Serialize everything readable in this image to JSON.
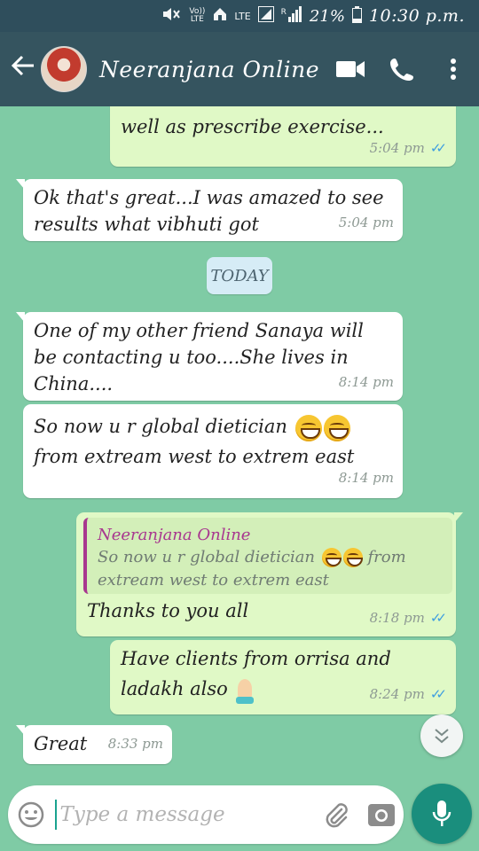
{
  "status_bar": {
    "signal_labels": [
      "Vo)) LTE",
      "LTE"
    ],
    "roaming": "R",
    "battery": "21%",
    "time": "10:30 p.m."
  },
  "header": {
    "contact_name": "Neeranjana Online"
  },
  "messages": [
    {
      "direction": "out",
      "text": "well as prescribe exercise...",
      "time": "5:04 pm",
      "read": true
    },
    {
      "direction": "in",
      "lines": [
        "Ok that's great...I was amazed to see",
        "results what vibhuti got"
      ],
      "time": "5:04 pm"
    },
    {
      "direction": "in",
      "lines": [
        "One of my other friend Sanaya will",
        "be contacting u too....She lives in",
        "China...."
      ],
      "time": "8:14 pm"
    },
    {
      "direction": "in",
      "lines": [
        "So now u r global dietician",
        "from extream west to extrem east"
      ],
      "time": "8:14 pm",
      "emoji": "grinning-face x2"
    },
    {
      "direction": "out",
      "quote": {
        "name": "Neeranjana Online",
        "lines": [
          "So now u r global dietician",
          "from",
          "extream west to extrem east"
        ]
      },
      "text": "Thanks to you all",
      "time": "8:18 pm",
      "read": true
    },
    {
      "direction": "out",
      "lines": [
        "Have clients from orrisa and",
        "ladakh also"
      ],
      "time": "8:24 pm",
      "read": true,
      "emoji": "folded-hands"
    },
    {
      "direction": "in",
      "text": "Great",
      "time": "8:33 pm"
    }
  ],
  "date_divider": "TODAY",
  "composer": {
    "placeholder": "Type a message"
  },
  "colors": {
    "chat_background": "#7fcba5",
    "header": "#35545f",
    "outgoing_bubble": "#e0f9c6",
    "incoming_bubble": "#ffffff",
    "read_tick": "#3e9ee0",
    "mic_button": "#1a8e7d",
    "quote_accent": "#a8378f"
  },
  "icons": {
    "back": "arrow-left-icon",
    "video": "video-camera-icon",
    "call": "phone-icon",
    "menu": "more-vertical-icon",
    "emoji": "emoji-icon",
    "attach": "paperclip-icon",
    "camera": "camera-icon",
    "mic": "microphone-icon",
    "scroll": "double-chevron-down-icon"
  }
}
